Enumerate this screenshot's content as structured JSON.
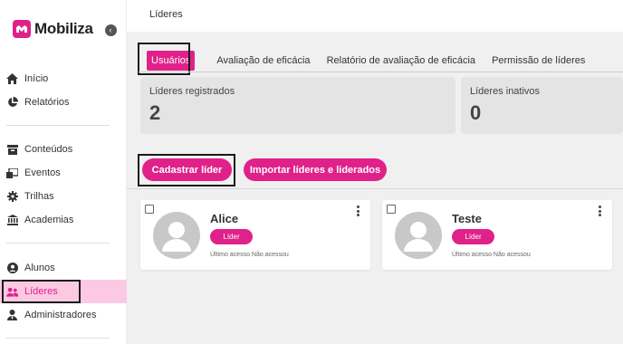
{
  "app": {
    "brand": "Mobiliza"
  },
  "sidebar": {
    "items": [
      {
        "label": "Início",
        "icon": "home-icon"
      },
      {
        "label": "Relatórios",
        "icon": "pie-chart-icon"
      },
      {
        "label": "Conteúdos",
        "icon": "inbox-icon"
      },
      {
        "label": "Eventos",
        "icon": "calendar-icon"
      },
      {
        "label": "Trilhas",
        "icon": "gear-icon"
      },
      {
        "label": "Academias",
        "icon": "bank-icon"
      },
      {
        "label": "Alunos",
        "icon": "user-circle-icon"
      },
      {
        "label": "Líderes",
        "icon": "users-icon",
        "active": true
      },
      {
        "label": "Administradores",
        "icon": "user-tie-icon"
      }
    ]
  },
  "header": {
    "title": "Líderes"
  },
  "tabs": [
    {
      "label": "Usuários",
      "active": true
    },
    {
      "label": "Avaliação de eficácia"
    },
    {
      "label": "Relatório de avaliação de eficácia"
    },
    {
      "label": "Permissão de líderes"
    }
  ],
  "stats": [
    {
      "label": "Líderes registrados",
      "value": "2"
    },
    {
      "label": "Líderes inativos",
      "value": "0"
    }
  ],
  "actions": {
    "register": "Cadastrar líder",
    "import": "Importar líderes e liderados"
  },
  "leaders": [
    {
      "name": "Alice",
      "role": "Líder",
      "last_access": "Último acesso Não acessou"
    },
    {
      "name": "Teste",
      "role": "Líder",
      "last_access": "Último acesso Não acessou"
    }
  ],
  "colors": {
    "accent": "#e0218a",
    "active_bg": "#fbc9e4",
    "panel": "#e4e4e4",
    "canvas": "#f0f0f0"
  }
}
